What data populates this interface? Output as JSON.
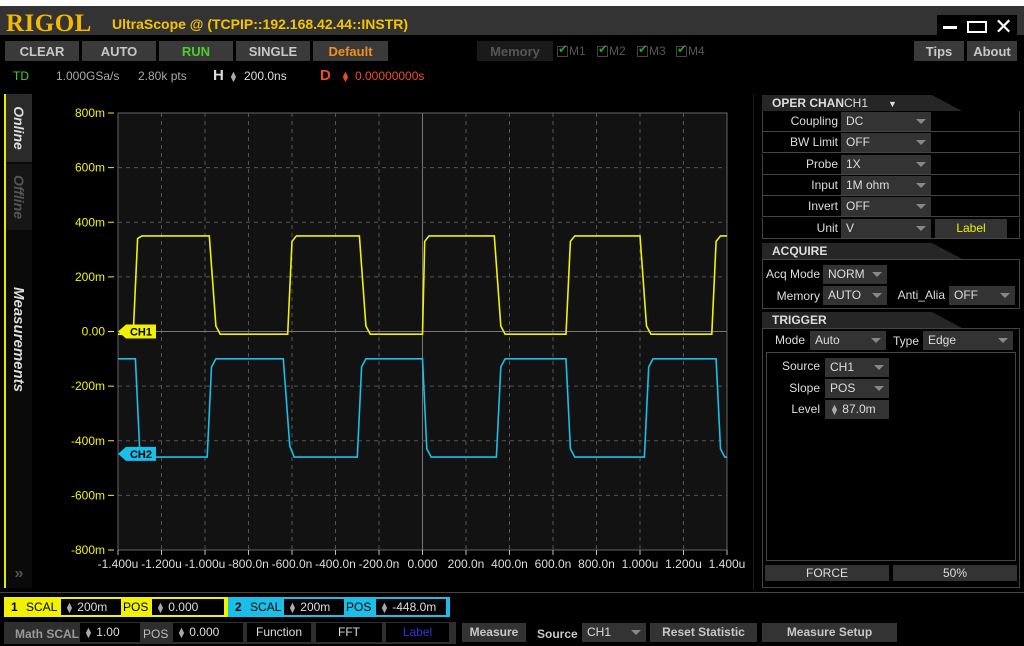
{
  "window": {
    "logo": "RIGOL",
    "title": "UltraScope   @ (TCPIP::192.168.42.44::INSTR)",
    "controls": [
      "minimize",
      "maximize",
      "close"
    ]
  },
  "toolbar": {
    "clear": "CLEAR",
    "auto": "AUTO",
    "run": "RUN",
    "single": "SINGLE",
    "default": "Default",
    "memory": "Memory",
    "memories": [
      "M1",
      "M2",
      "M3",
      "M4"
    ],
    "tips": "Tips",
    "about": "About"
  },
  "status": {
    "mode": "TD",
    "sample_rate": "1.000GSa/s",
    "points": "2.80k pts",
    "h_label": "H",
    "h_value": "200.0ns",
    "d_label": "D",
    "d_value": "0.00000000s"
  },
  "side_tabs": {
    "online": "Online",
    "offline": "Offline",
    "measurements": "Measurements"
  },
  "colors": {
    "ch1": "#f2f200",
    "ch2": "#19bfe8",
    "accent_orange": "#f09020",
    "run_green": "#4ccf2a",
    "delay_red": "#f04a2a"
  },
  "chart_data": {
    "type": "line",
    "title": "",
    "xlabel": "",
    "ylabel": "",
    "x_ticks": [
      "-1.400u",
      "-1.200u",
      "-1.000u",
      "-800.0n",
      "-600.0n",
      "-400.0n",
      "-200.0n",
      "0.000",
      "200.0n",
      "400.0n",
      "600.0n",
      "800.0n",
      "1.000u",
      "1.200u",
      "1.400u"
    ],
    "y_ticks": [
      "800m",
      "600m",
      "400m",
      "200m",
      "0.00",
      "-200m",
      "-400m",
      "-600m",
      "-800m"
    ],
    "xlim_ns": [
      -1400,
      1400
    ],
    "ylim_mV": [
      -800,
      800
    ],
    "grid": true,
    "series": [
      {
        "name": "CH1",
        "marker_label": "CH1",
        "offset_mV": 0,
        "high_mV": 350,
        "low_mV": -10,
        "points_ns_mV": [
          [
            -1400,
            -10
          ],
          [
            -1330,
            -10
          ],
          [
            -1310,
            340
          ],
          [
            -1290,
            350
          ],
          [
            -980,
            350
          ],
          [
            -950,
            20
          ],
          [
            -930,
            -10
          ],
          [
            -620,
            -10
          ],
          [
            -600,
            330
          ],
          [
            -580,
            350
          ],
          [
            -290,
            350
          ],
          [
            -260,
            20
          ],
          [
            -240,
            -10
          ],
          [
            0,
            -10
          ],
          [
            10,
            330
          ],
          [
            30,
            350
          ],
          [
            330,
            350
          ],
          [
            360,
            20
          ],
          [
            380,
            -10
          ],
          [
            660,
            -10
          ],
          [
            680,
            330
          ],
          [
            700,
            350
          ],
          [
            1000,
            350
          ],
          [
            1030,
            20
          ],
          [
            1050,
            -10
          ],
          [
            1330,
            -10
          ],
          [
            1350,
            330
          ],
          [
            1370,
            350
          ],
          [
            1400,
            350
          ]
        ]
      },
      {
        "name": "CH2",
        "marker_label": "CH2",
        "offset_mV": -448,
        "high_mV": -100,
        "low_mV": -460,
        "points_ns_mV": [
          [
            -1400,
            -100
          ],
          [
            -1320,
            -100
          ],
          [
            -1300,
            -440
          ],
          [
            -1290,
            -460
          ],
          [
            -990,
            -460
          ],
          [
            -970,
            -130
          ],
          [
            -950,
            -100
          ],
          [
            -640,
            -100
          ],
          [
            -610,
            -420
          ],
          [
            -590,
            -460
          ],
          [
            -300,
            -460
          ],
          [
            -280,
            -130
          ],
          [
            -260,
            -100
          ],
          [
            0,
            -100
          ],
          [
            20,
            -430
          ],
          [
            40,
            -460
          ],
          [
            340,
            -460
          ],
          [
            360,
            -130
          ],
          [
            380,
            -100
          ],
          [
            660,
            -100
          ],
          [
            680,
            -430
          ],
          [
            700,
            -460
          ],
          [
            1020,
            -460
          ],
          [
            1040,
            -130
          ],
          [
            1060,
            -100
          ],
          [
            1350,
            -100
          ],
          [
            1370,
            -430
          ],
          [
            1390,
            -460
          ],
          [
            1400,
            -460
          ]
        ]
      }
    ]
  },
  "oper_chan": {
    "header": "OPER CHAN",
    "channel": "CH1",
    "rows": [
      {
        "label": "Coupling",
        "value": "DC"
      },
      {
        "label": "BW Limit",
        "value": "OFF"
      },
      {
        "label": "Probe",
        "value": "1X"
      },
      {
        "label": "Input",
        "value": "1M ohm"
      },
      {
        "label": "Invert",
        "value": "OFF"
      },
      {
        "label": "Unit",
        "value": "V"
      }
    ],
    "label_button": "Label"
  },
  "acquire": {
    "header": "ACQUIRE",
    "acq_mode_label": "Acq Mode",
    "acq_mode": "NORM",
    "memory_label": "Memory",
    "memory": "AUTO",
    "anti_alias_label": "Anti_Alia",
    "anti_alias": "OFF"
  },
  "trigger": {
    "header": "TRIGGER",
    "mode_label": "Mode",
    "mode": "Auto",
    "type_label": "Type",
    "type": "Edge",
    "source_label": "Source",
    "source": "CH1",
    "slope_label": "Slope",
    "slope": "POS",
    "level_label": "Level",
    "level": "87.0m",
    "force": "FORCE",
    "fifty": "50%"
  },
  "channels_bar": {
    "ch1": {
      "num": "1",
      "scal_label": "SCAL",
      "scal": "200m",
      "pos_label": "POS",
      "pos": "0.000"
    },
    "ch2": {
      "num": "2",
      "scal_label": "SCAL",
      "scal": "200m",
      "pos_label": "POS",
      "pos": "-448.0m"
    }
  },
  "math_bar": {
    "math_scal_label": "Math SCAL",
    "scal": "1.00",
    "pos_label": "POS",
    "pos": "0.000",
    "function": "Function",
    "fft": "FFT",
    "label": "Label",
    "measure": "Measure",
    "source_label": "Source",
    "source": "CH1",
    "reset_statistic": "Reset  Statistic",
    "measure_setup": "Measure Setup"
  }
}
